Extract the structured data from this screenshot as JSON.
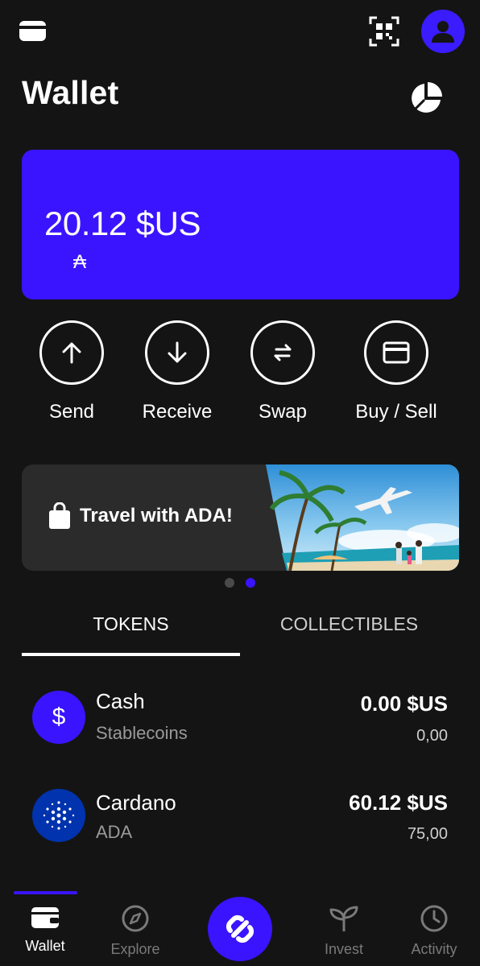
{
  "header": {
    "title": "Wallet",
    "icons": [
      "wallet-icon",
      "qr-scan-icon",
      "profile-icon",
      "pie-chart-icon"
    ]
  },
  "balance": {
    "amount": "20.12 $US",
    "ada_symbol": "₳"
  },
  "actions": [
    {
      "label": "Send",
      "icon": "arrow-up-icon"
    },
    {
      "label": "Receive",
      "icon": "arrow-down-icon"
    },
    {
      "label": "Swap",
      "icon": "swap-icon"
    },
    {
      "label": "Buy / Sell",
      "icon": "card-icon"
    }
  ],
  "banner": {
    "text": "Travel with ADA!",
    "carousel": {
      "count": 2,
      "active": 2
    }
  },
  "tabs": [
    {
      "label": "TOKENS",
      "active": true
    },
    {
      "label": "COLLECTIBLES",
      "active": false
    }
  ],
  "tokens": [
    {
      "name": "Cash",
      "subtitle": "Stablecoins",
      "fiat": "0.00 $US",
      "amount": "0,00",
      "icon": "dollar-icon"
    },
    {
      "name": "Cardano",
      "subtitle": "ADA",
      "fiat": "60.12 $US",
      "amount": "75,00",
      "icon": "cardano-icon"
    }
  ],
  "nav": [
    {
      "label": "Wallet",
      "active": true
    },
    {
      "label": "Explore",
      "active": false
    },
    {
      "label": "",
      "icon": "app-logo-icon"
    },
    {
      "label": "Invest",
      "active": false
    },
    {
      "label": "Activity",
      "active": false
    }
  ],
  "colors": {
    "accent": "#3a14ff",
    "background": "#141414",
    "surface": "#2b2b2b"
  }
}
